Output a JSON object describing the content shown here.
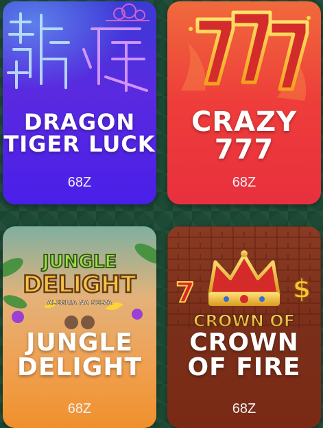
{
  "games": [
    {
      "title_line1": "DRAGON",
      "title_line2": "TIGER LUCK",
      "price": "68Z",
      "colors": {
        "top": "#5a2ae0",
        "bottom": "#4a1fe8",
        "accent": "#9a4dff"
      }
    },
    {
      "title_line1": "CRAZY",
      "title_line2": "777",
      "price": "68Z",
      "colors": {
        "top": "#f0563a",
        "bottom": "#e8303e",
        "accent": "#ffce3a"
      }
    },
    {
      "title_line1": "JUNGLE",
      "title_line2": "DELIGHT",
      "price": "68Z",
      "logo_line1": "JUNGLE",
      "logo_line2": "DELIGHT",
      "logo_sub": "ALEGRIA NA SELVA",
      "colors": {
        "top": "#e8a05a",
        "bottom": "#f0902c",
        "accent": "#6fbf3a"
      }
    },
    {
      "title_line1": "CROWN",
      "title_line2": "OF FIRE",
      "price": "68Z",
      "logo_text": "CROWN OF",
      "colors": {
        "top": "#7a2a18",
        "bottom": "#7a2a14",
        "accent": "#f5c43a"
      }
    }
  ]
}
